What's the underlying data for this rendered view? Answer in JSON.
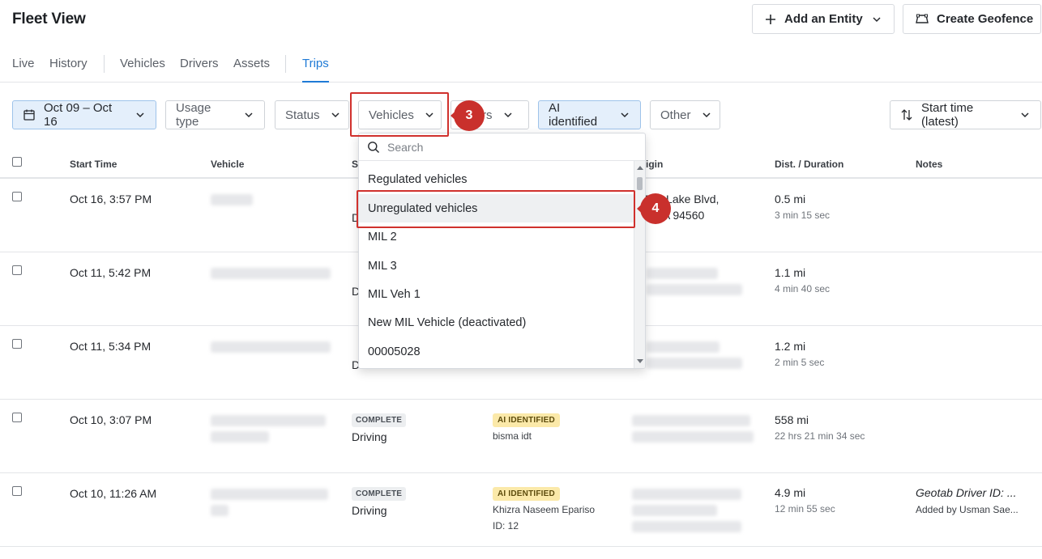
{
  "header": {
    "title": "Fleet View",
    "add_entity_label": "Add an Entity",
    "create_geofence_label": "Create Geofence"
  },
  "tabs": [
    {
      "label": "Live"
    },
    {
      "label": "History"
    },
    {
      "label": "Vehicles"
    },
    {
      "label": "Drivers"
    },
    {
      "label": "Assets"
    },
    {
      "label": "Trips",
      "active": true
    }
  ],
  "filters": {
    "date_range": "Oct 09 – Oct 16",
    "usage_type": "Usage type",
    "status": "Status",
    "vehicles": "Vehicles",
    "drivers_partial": "rs",
    "ai_identified": "AI identified",
    "other": "Other",
    "sort": "Start time (latest)"
  },
  "callouts": {
    "step3": "3",
    "step4": "4"
  },
  "table": {
    "columns": {
      "start_time": "Start Time",
      "vehicle": "Vehicle",
      "status_partial": "S",
      "origin_partial": "igin",
      "dist_duration": "Dist. / Duration",
      "notes": "Notes"
    },
    "rows": [
      {
        "start_time": "Oct 16, 3:57 PM",
        "status_line2_partial": "D",
        "origin_line1_partial": "5200 Lake Blvd,",
        "origin_line2_partial": ", CA 94560",
        "distance": "0.5 mi",
        "duration": "3 min 15 sec"
      },
      {
        "start_time": "Oct 11, 5:42 PM",
        "status_line2_partial": "D",
        "distance": "1.1 mi",
        "duration": "4 min 40 sec"
      },
      {
        "start_time": "Oct 11, 5:34 PM",
        "status_line2_partial": "D",
        "distance": "1.2 mi",
        "duration": "2 min 5 sec"
      },
      {
        "start_time": "Oct 10, 3:07 PM",
        "status_tag": "COMPLETE",
        "status_text": "Driving",
        "ai_tag": "AI IDENTIFIED",
        "driver": "bisma idt",
        "distance": "558 mi",
        "duration": "22 hrs 21 min 34 sec"
      },
      {
        "start_time": "Oct 10, 11:26 AM",
        "status_tag": "COMPLETE",
        "status_text": "Driving",
        "ai_tag": "AI IDENTIFIED",
        "driver": "Khizra Naseem Epariso",
        "driver_id": "ID: 12",
        "distance": "4.9 mi",
        "duration": "12 min 55 sec",
        "note_title": "Geotab Driver ID: ...",
        "note_by": "Added by Usman Sae..."
      }
    ]
  },
  "vehicles_dropdown": {
    "search_placeholder": "Search",
    "options": [
      "Regulated vehicles",
      "Unregulated vehicles",
      "MIL 2",
      "MIL 3",
      "MIL Veh 1",
      "New MIL Vehicle (deactivated)",
      "00005028"
    ],
    "highlighted": "Unregulated vehicles"
  },
  "colors": {
    "accent": "#1f7ad6",
    "callout": "#c9302c",
    "ai_tag": "#fbe9a9"
  }
}
